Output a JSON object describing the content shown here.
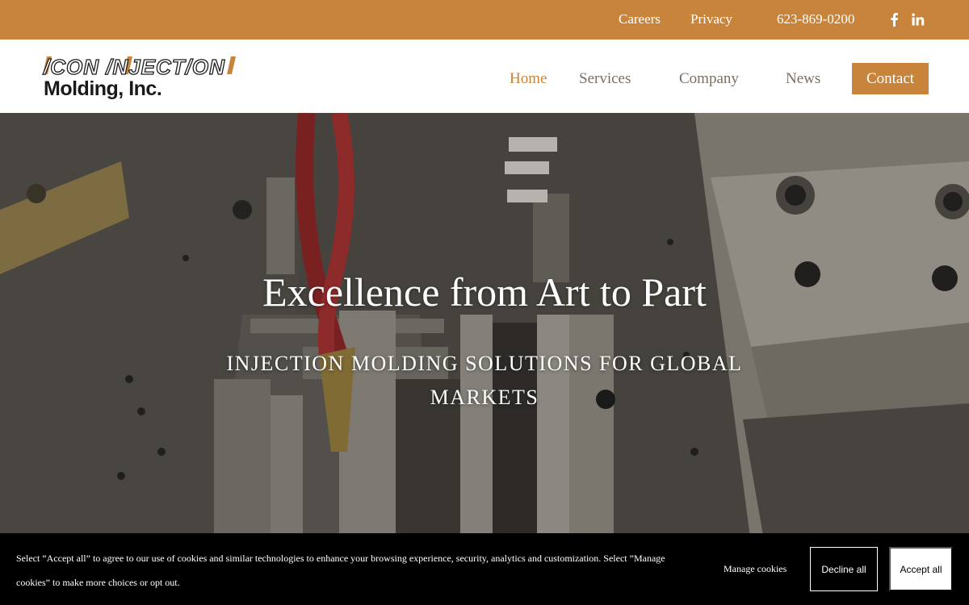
{
  "topbar": {
    "careers": "Careers",
    "privacy": "Privacy",
    "phone": "623-869-0200",
    "social": [
      "facebook-icon",
      "linkedin-icon"
    ]
  },
  "logo": {
    "line1": "/CON /NJECT/ON",
    "line2": "Molding, Inc."
  },
  "nav": {
    "home": "Home",
    "services": "Services",
    "company": "Company",
    "news": "News",
    "contact": "Contact",
    "active": "Home"
  },
  "hero": {
    "title": "Excellence from Art to Part",
    "subtitle": "INJECTION MOLDING SOLUTIONS FOR GLOBAL MARKETS"
  },
  "cookie": {
    "text": "Select “Accept all” to agree to our use of cookies and similar technologies to enhance your browsing experience, security, analytics and customization. Select ”Manage cookies” to make more choices or opt out.",
    "manage": "Manage cookies",
    "decline": "Decline all",
    "accept": "Accept all"
  },
  "colors": {
    "brand": "#c8843a",
    "nav_text": "#7a6f62",
    "banner_bg": "#000000"
  }
}
